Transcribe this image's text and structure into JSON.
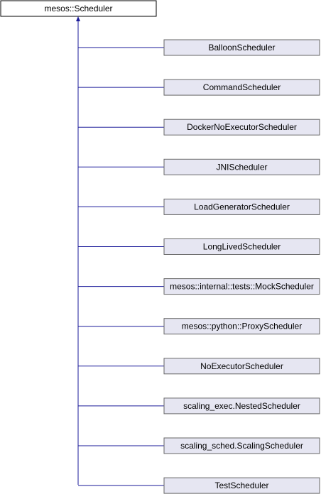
{
  "base_class": {
    "label": "mesos::Scheduler"
  },
  "derived_classes": [
    {
      "label": "BalloonScheduler"
    },
    {
      "label": "CommandScheduler"
    },
    {
      "label": "DockerNoExecutorScheduler"
    },
    {
      "label": "JNIScheduler"
    },
    {
      "label": "LoadGeneratorScheduler"
    },
    {
      "label": "LongLivedScheduler"
    },
    {
      "label": "mesos::internal::tests::MockScheduler"
    },
    {
      "label": "mesos::python::ProxyScheduler"
    },
    {
      "label": "NoExecutorScheduler"
    },
    {
      "label": "scaling_exec.NestedScheduler"
    },
    {
      "label": "scaling_sched.ScalingScheduler"
    },
    {
      "label": "TestScheduler"
    }
  ],
  "colors": {
    "edge": "#1a1a99",
    "child_fill": "#e6e6f2",
    "child_stroke": "#666666"
  }
}
